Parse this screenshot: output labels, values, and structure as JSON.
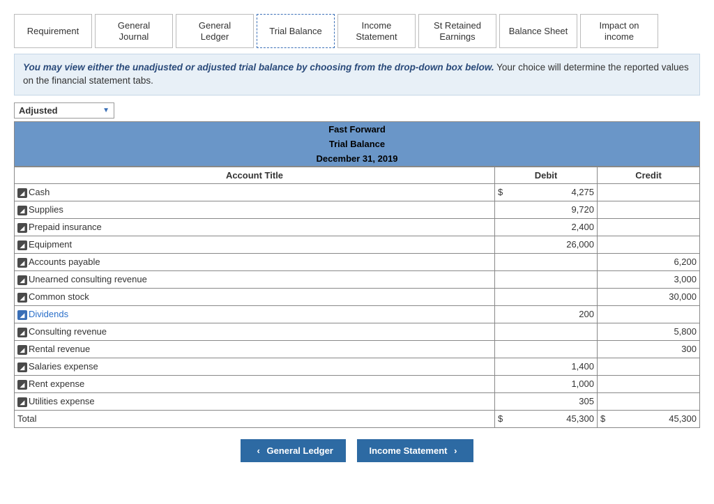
{
  "tabs": [
    {
      "label": "Requirement"
    },
    {
      "label": "General\nJournal"
    },
    {
      "label": "General\nLedger"
    },
    {
      "label": "Trial Balance"
    },
    {
      "label": "Income\nStatement"
    },
    {
      "label": "St Retained\nEarnings"
    },
    {
      "label": "Balance Sheet"
    },
    {
      "label": "Impact on\nincome"
    }
  ],
  "info": {
    "emph": "You may view either the unadjusted or adjusted trial balance by choosing from the drop-down box below.",
    "rest": " Your choice will determine the reported values on the financial statement tabs."
  },
  "dropdown": {
    "value": "Adjusted"
  },
  "header": {
    "company": "Fast Forward",
    "report": "Trial Balance",
    "date": "December 31, 2019"
  },
  "columns": {
    "account": "Account Title",
    "debit": "Debit",
    "credit": "Credit"
  },
  "rows": [
    {
      "title": "Cash",
      "debit": "4,275",
      "debit_cur": "$",
      "credit": "",
      "icon": "dark"
    },
    {
      "title": "Supplies",
      "debit": "9,720",
      "credit": "",
      "icon": "dark"
    },
    {
      "title": "Prepaid insurance",
      "debit": "2,400",
      "credit": "",
      "icon": "dark"
    },
    {
      "title": "Equipment",
      "debit": "26,000",
      "credit": "",
      "icon": "dark"
    },
    {
      "title": "Accounts payable",
      "debit": "",
      "credit": "6,200",
      "icon": "dark"
    },
    {
      "title": "Unearned consulting revenue",
      "debit": "",
      "credit": "3,000",
      "icon": "dark"
    },
    {
      "title": "Common stock",
      "debit": "",
      "credit": "30,000",
      "icon": "dark"
    },
    {
      "title": "Dividends",
      "debit": "200",
      "credit": "",
      "icon": "blue",
      "link": true
    },
    {
      "title": "Consulting revenue",
      "debit": "",
      "credit": "5,800",
      "icon": "dark"
    },
    {
      "title": "Rental revenue",
      "debit": "",
      "credit": "300",
      "icon": "dark"
    },
    {
      "title": "Salaries expense",
      "debit": "1,400",
      "credit": "",
      "icon": "dark"
    },
    {
      "title": "Rent expense",
      "debit": "1,000",
      "credit": "",
      "icon": "dark"
    },
    {
      "title": "Utilities expense",
      "debit": "305",
      "credit": "",
      "icon": "dark"
    }
  ],
  "total": {
    "label": "Total",
    "debit_cur": "$",
    "debit": "45,300",
    "credit_cur": "$",
    "credit": "45,300"
  },
  "nav": {
    "prev": "General Ledger",
    "next": "Income Statement"
  }
}
